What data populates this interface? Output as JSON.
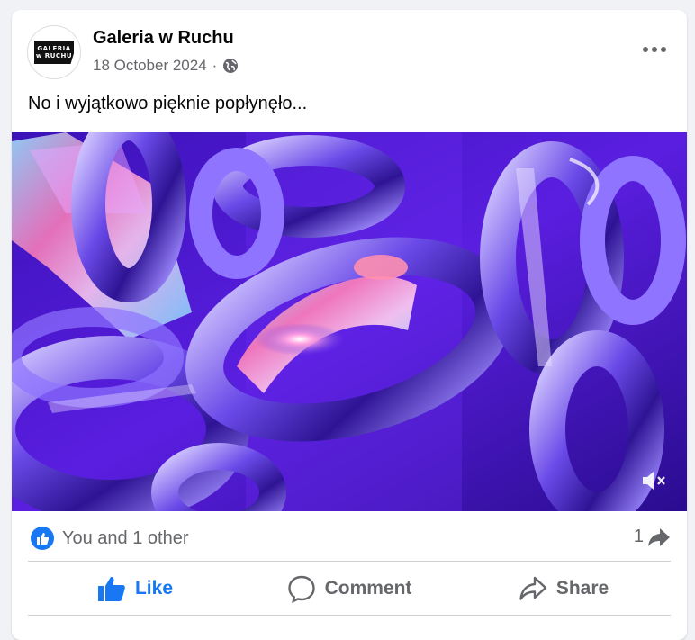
{
  "post": {
    "author": "Galeria w Ruchu",
    "avatar_text_line1": "GALERIA",
    "avatar_text_line2": "w RUCHU",
    "date": "18 October 2024",
    "separator": "·",
    "audience_icon": "globe-icon",
    "text": "No i wyjątkowo pięknie popłynęło..."
  },
  "video": {
    "muted": true,
    "mute_icon": "speaker-muted-icon"
  },
  "reactions": {
    "summary": "You and 1 other",
    "reaction_icon": "like-icon",
    "share_count": "1",
    "share_count_icon": "share-arrow-icon"
  },
  "actions": {
    "like_label": "Like",
    "comment_label": "Comment",
    "share_label": "Share",
    "like_active": true
  },
  "colors": {
    "accent": "#1877f2",
    "secondary_text": "#65676b",
    "video_purple": "#3a14c8"
  }
}
